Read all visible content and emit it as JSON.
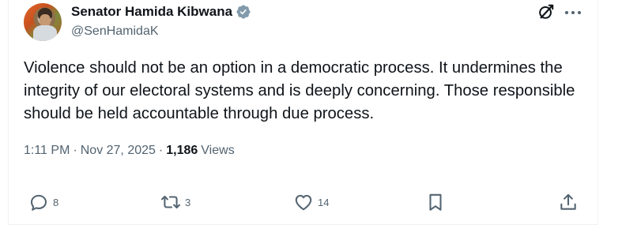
{
  "author": {
    "name": "Senator Hamida Kibwana",
    "handle": "@SenHamidaK"
  },
  "tweet": {
    "text": "Violence should not be an option in a democratic process. It undermines the integrity of our electoral systems and is deeply concerning.  Those responsible should be held accountable through due process."
  },
  "meta": {
    "time": "1:11 PM",
    "separator": "·",
    "date": "Nov 27, 2025",
    "views_count": "1,186",
    "views_label": "Views"
  },
  "actions": {
    "reply_count": "8",
    "retweet_count": "3",
    "like_count": "14"
  },
  "colors": {
    "text": "#0f1419",
    "secondary": "#536471",
    "verified": "#829aab"
  },
  "icons": [
    "verified-badge-icon",
    "grok-icon",
    "more-icon",
    "reply-icon",
    "retweet-icon",
    "like-icon",
    "bookmark-icon",
    "share-icon"
  ]
}
